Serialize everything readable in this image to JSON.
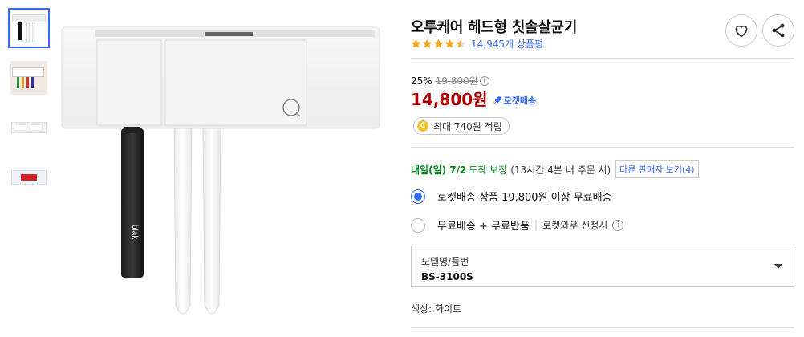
{
  "product": {
    "title": "오투케어 헤드형 칫솔살균기",
    "rating_stars": 4.5,
    "review_count": "14,945개 상품평"
  },
  "pricing": {
    "discount_rate": "25%",
    "original_price": "19,800원",
    "info_symbol": "i",
    "sale_price": "14,800원",
    "rocket_label": "로켓배송"
  },
  "reward": {
    "coin_symbol": "C",
    "text": "최대 740원 적립"
  },
  "delivery": {
    "arrival_date": "내일(일) 7/2",
    "arrival_suffix": "도착 보장",
    "deadline": "(13시간 4분 내 주문 시)",
    "other_sellers": "다른 판매자 보기(4)"
  },
  "shipping_options": [
    {
      "label": "로켓배송 상품 19,800원 이상 무료배송",
      "checked": true
    },
    {
      "label": "무료배송 + 무료반품",
      "sub": "로켓와우 신청시",
      "checked": false
    }
  ],
  "option_select": {
    "label": "모델명/품번",
    "value": "BS-3100S"
  },
  "color": {
    "text": "색상: 화이트"
  },
  "main_image": {
    "brand_text": "blak",
    "icon_letter": "Q"
  },
  "colors": {
    "accent": "#346aff",
    "price_red": "#ae0000",
    "arrival_green": "#00891a",
    "star_orange": "#f5a623"
  }
}
